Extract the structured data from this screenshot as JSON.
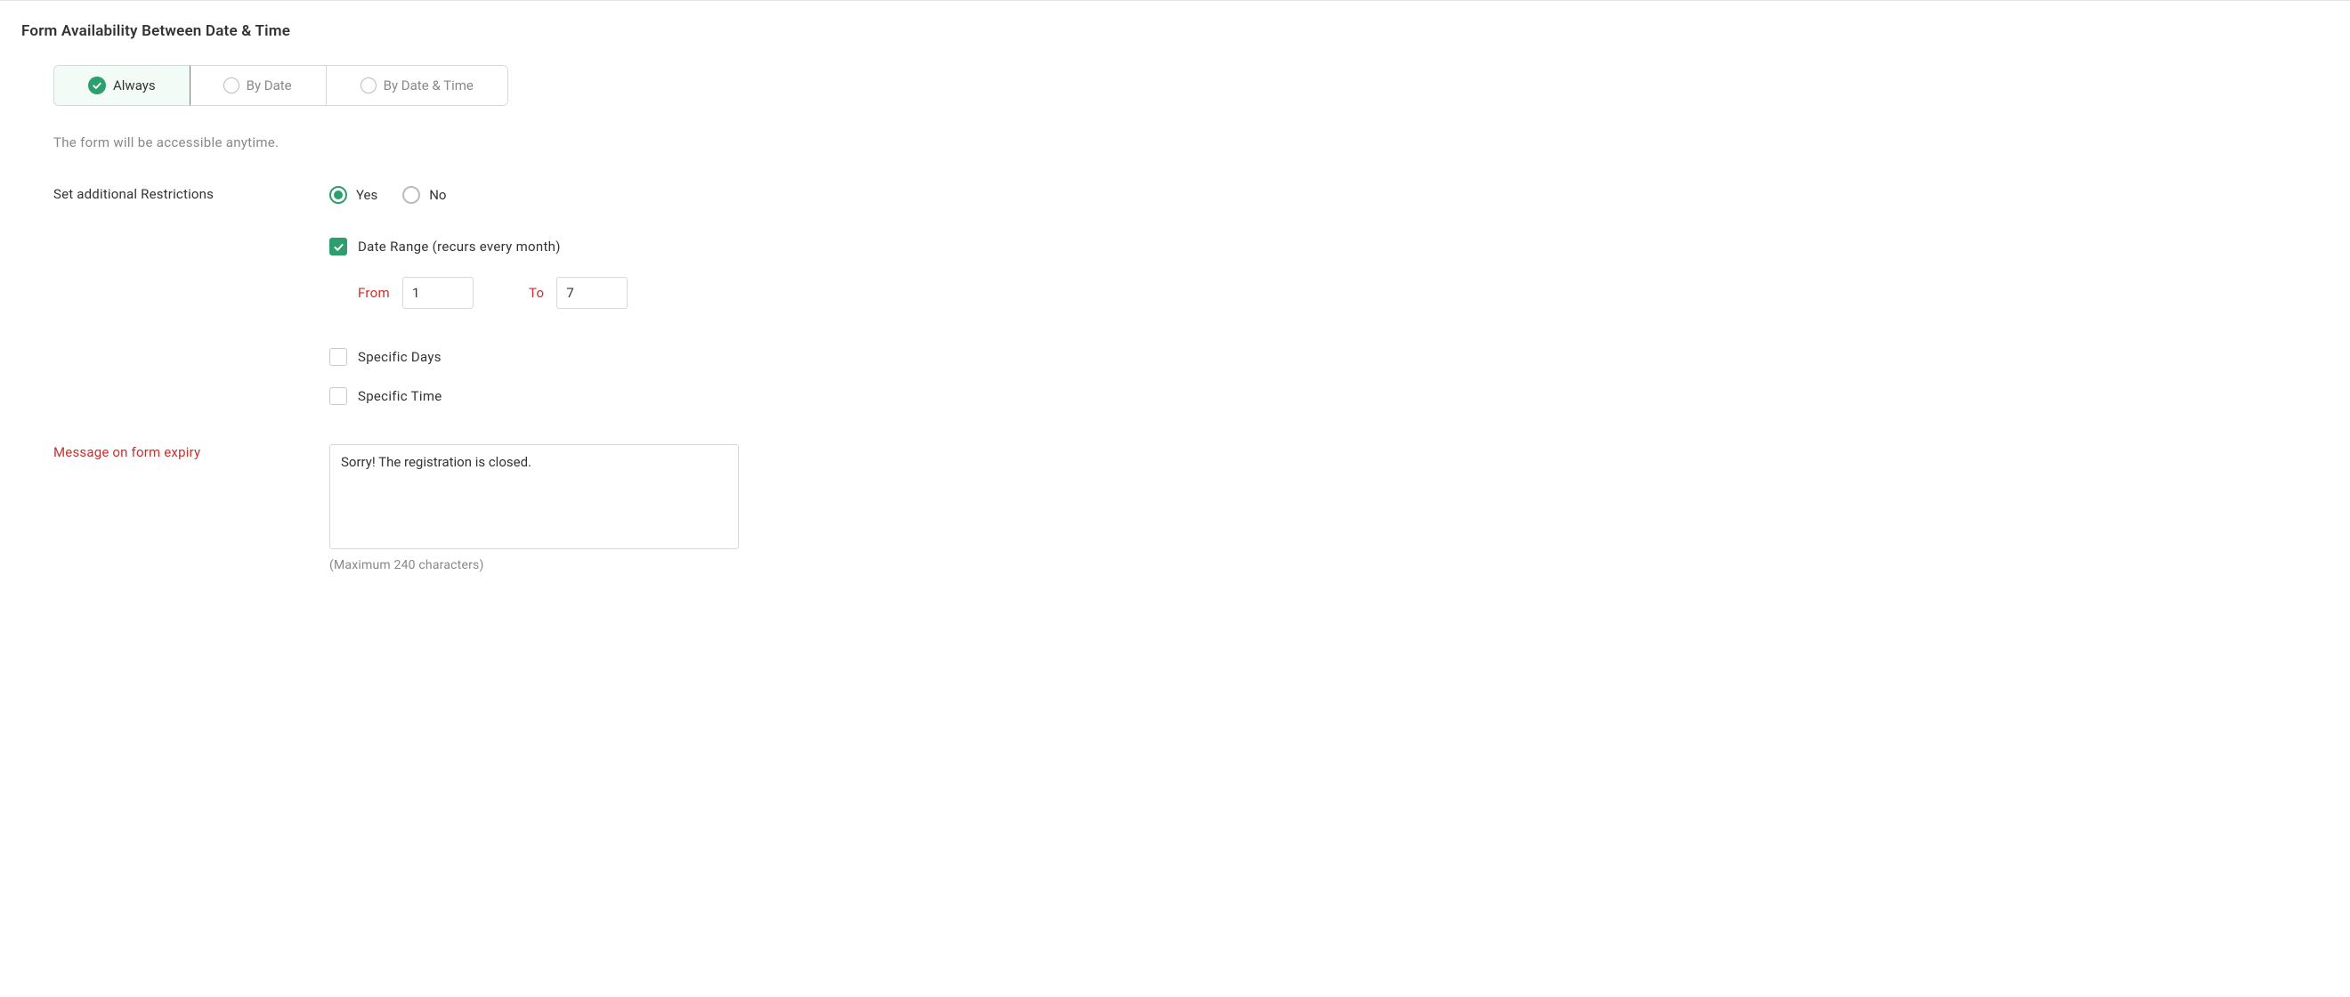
{
  "section_title": "Form Availability Between Date & Time",
  "tabs": {
    "always": "Always",
    "by_date": "By Date",
    "by_date_time": "By Date & Time"
  },
  "helper_text": "The form will be accessible anytime.",
  "restrictions_label": "Set additional Restrictions",
  "radio": {
    "yes": "Yes",
    "no": "No"
  },
  "checkboxes": {
    "date_range": "Date Range (recurs every month)",
    "specific_days": "Specific Days",
    "specific_time": "Specific Time"
  },
  "date_range": {
    "from_label": "From",
    "from_value": "1",
    "to_label": "To",
    "to_value": "7"
  },
  "expiry": {
    "label": "Message on form expiry",
    "value": "Sorry! The registration is closed.",
    "char_limit": "(Maximum 240 characters)"
  }
}
